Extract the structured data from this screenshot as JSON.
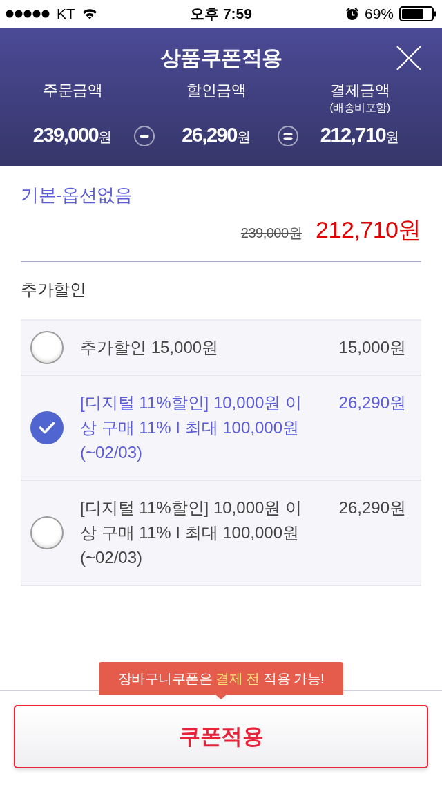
{
  "status_bar": {
    "carrier": "KT",
    "time": "오후 7:59",
    "battery": "69%"
  },
  "header": {
    "title": "상품쿠폰적용",
    "summary": [
      {
        "label": "주문금액",
        "amount": "**239,000**원"
      },
      {
        "label": "할인금액",
        "amount": "**26,290**원"
      },
      {
        "label": "결제금액",
        "note": "(배송비포함)",
        "amount": "**212,710**원"
      }
    ]
  },
  "product": {
    "name": "기본-옵션없음",
    "original_price": "239,000원",
    "sale_price": "212,710원"
  },
  "extra_discount": {
    "title": "추가할인",
    "coupons": [
      {
        "text": "추가할인 15,000원",
        "amount": "15,000원",
        "selected": false
      },
      {
        "text": "[디지털 11%할인] 10,000원 이상 구매 11% I 최대 100,000원 (~02/03)",
        "amount": "26,290원",
        "selected": true
      },
      {
        "text": "[디지털 11%할인] 10,000원 이상 구매 11% I 최대 100,000원 (~02/03)",
        "amount": "26,290원",
        "selected": false
      }
    ]
  },
  "footer": {
    "notice": "장바구니쿠폰은 **결제 전** 적용 가능!",
    "apply_button": "쿠폰적용"
  }
}
